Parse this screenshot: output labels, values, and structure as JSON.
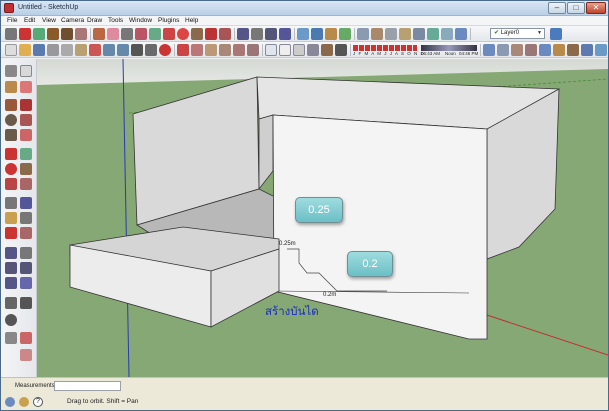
{
  "window": {
    "title": "Untitled - SketchUp",
    "min": "–",
    "max": "□",
    "close": "✕"
  },
  "menu": [
    "File",
    "Edit",
    "View",
    "Camera",
    "Draw",
    "Tools",
    "Window",
    "Plugins",
    "Help"
  ],
  "layer": {
    "selected": "Layer0"
  },
  "shadow": {
    "time_left": "06:43 AM",
    "noon": "Noon",
    "time_right": "04:46 PM",
    "months": "J F M A M J J A S O N D"
  },
  "colors": {
    "sky": "#d8dcd8",
    "ground": "#86a874",
    "accent": "#c03030"
  },
  "callouts": {
    "upper": "0.25",
    "lower": "0.2"
  },
  "dims": {
    "upper": "0.25m",
    "lower": "0.2m"
  },
  "caption": "สร้างบันได",
  "status": {
    "measurements_label": "Measurements",
    "hint": "Drag to orbit.  Shift = Pan"
  }
}
